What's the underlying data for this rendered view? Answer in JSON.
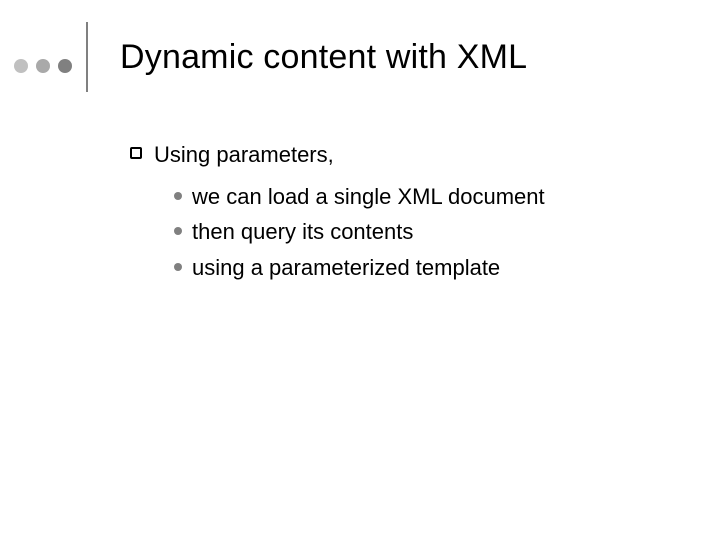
{
  "decoration": {
    "dot_colors": [
      "#c0c0c0",
      "#a9a9a9",
      "#808080"
    ]
  },
  "title": "Dynamic content with XML",
  "bullets": [
    {
      "text": "Using parameters,",
      "children": [
        "we can load a single XML document",
        "then query its contents",
        "using a parameterized template"
      ]
    }
  ]
}
